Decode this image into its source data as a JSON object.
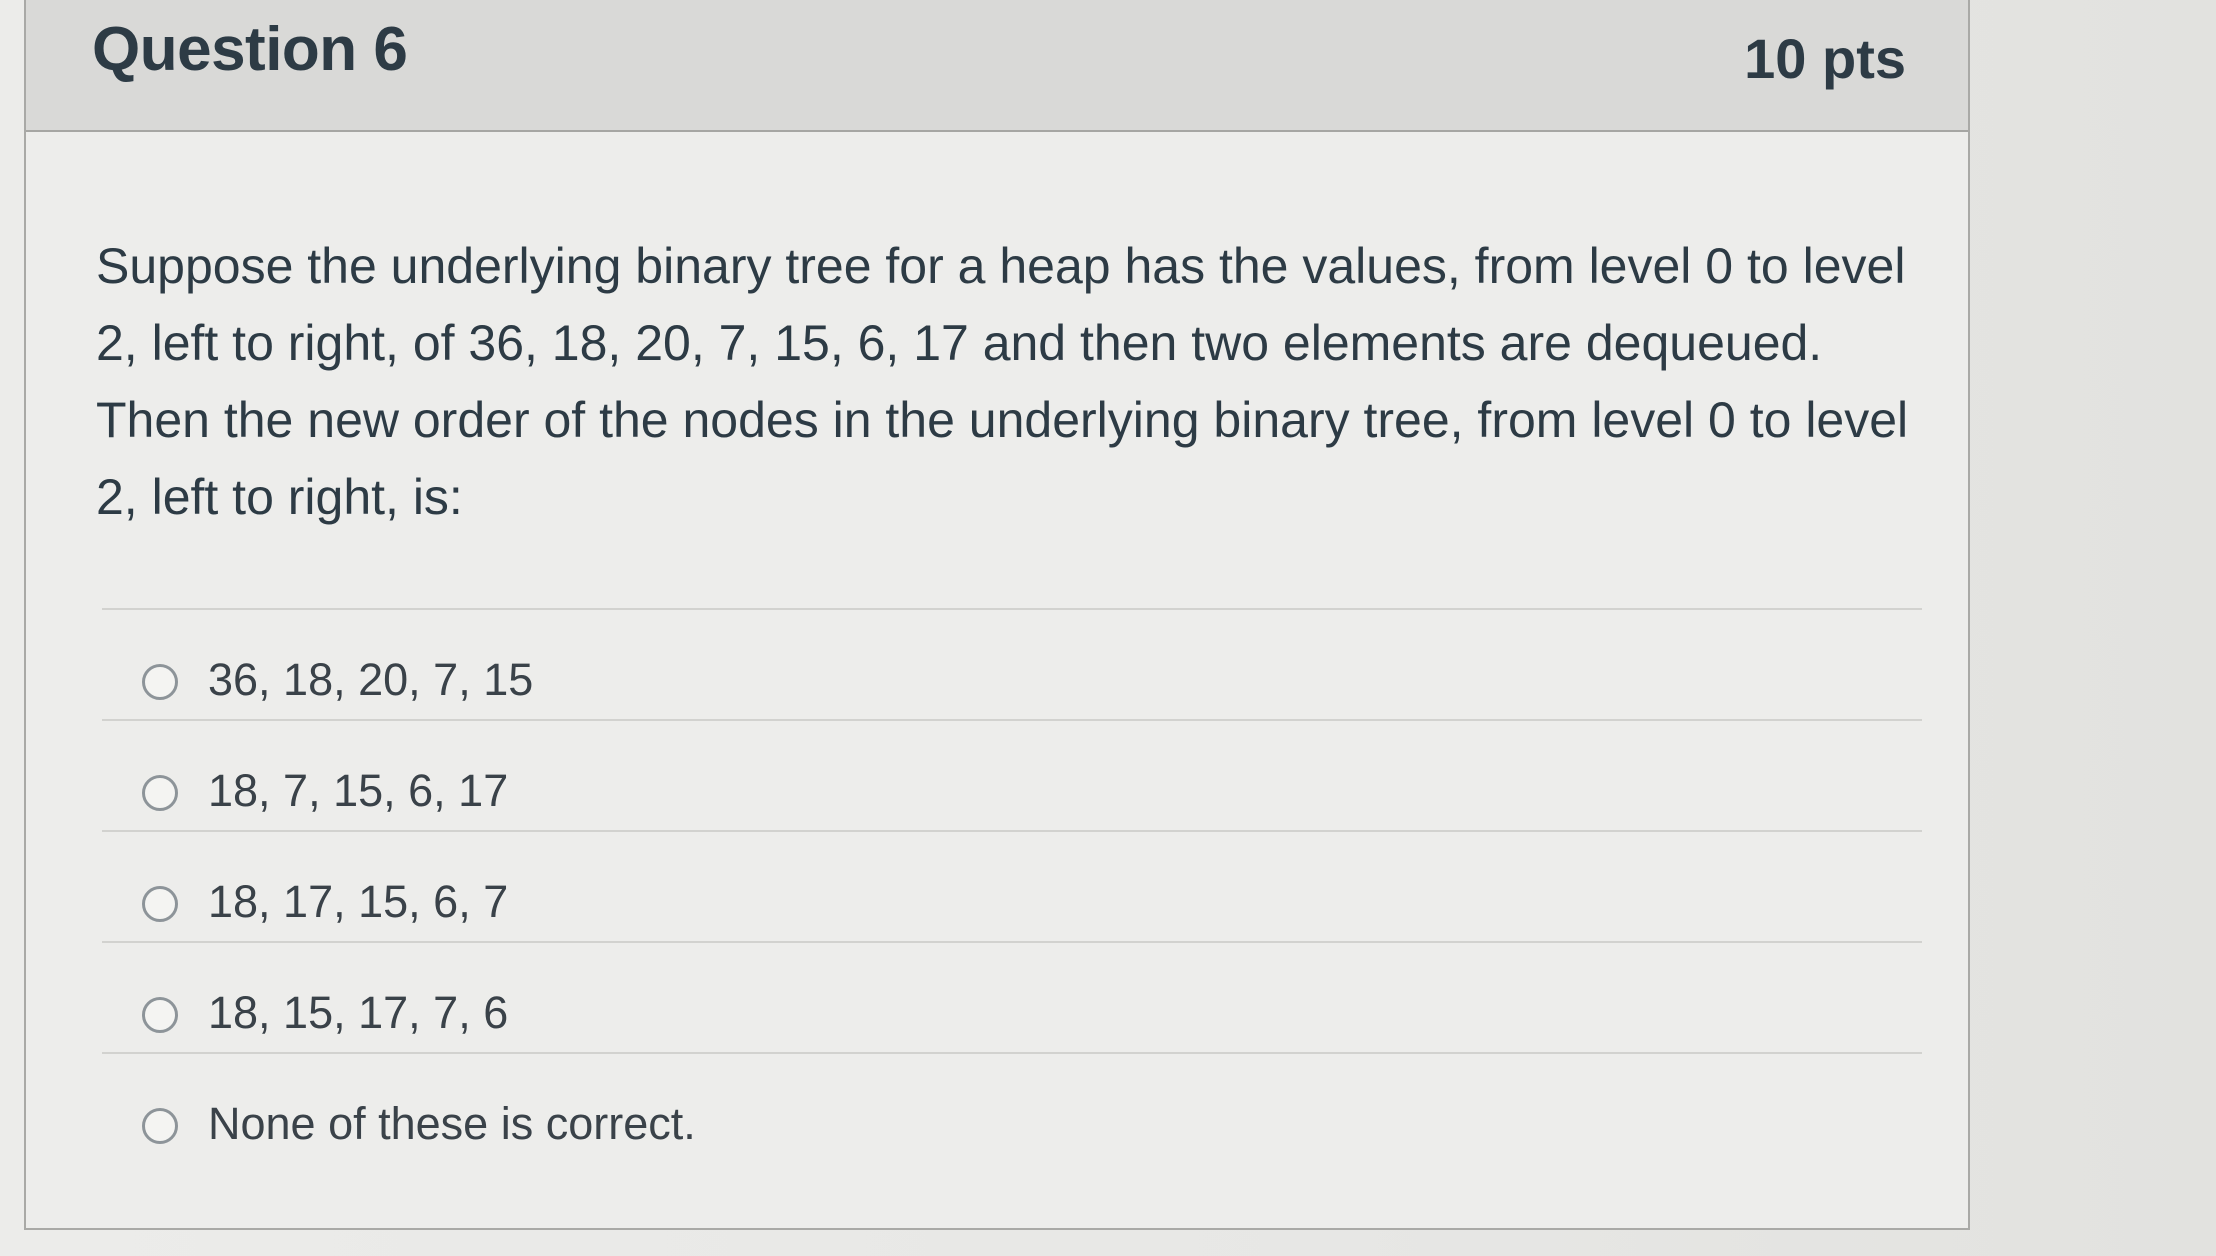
{
  "question": {
    "title": "Question 6",
    "points": "10 pts",
    "text": "Suppose the underlying binary tree for a heap has the values, from level 0 to level 2, left to right, of 36, 18, 20, 7, 15, 6, 17 and then two elements are dequeued. Then the new order of the nodes in the underlying binary tree, from level 0 to level 2, left to right, is:"
  },
  "answers": [
    {
      "label": "36, 18, 20, 7, 15"
    },
    {
      "label": "18, 7, 15, 6, 17"
    },
    {
      "label": "18, 17, 15, 6, 7"
    },
    {
      "label": "18, 15, 17, 7, 6"
    },
    {
      "label": "None of these is correct."
    }
  ],
  "colors": {
    "text": "#2d3b45",
    "header_bg": "#d9d9d7",
    "card_bg": "#ededeb",
    "divider": "#d2d2cf"
  }
}
